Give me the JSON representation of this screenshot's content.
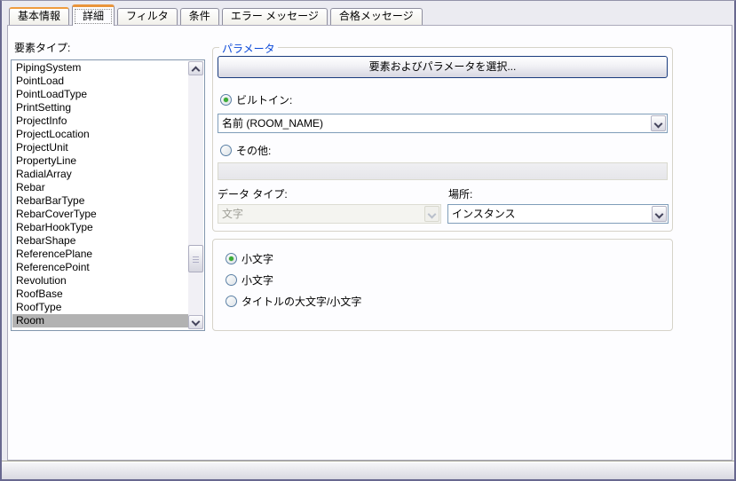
{
  "tabs": [
    {
      "label": "基本情報",
      "state": "hot"
    },
    {
      "label": "詳細",
      "state": "selected"
    },
    {
      "label": "フィルタ",
      "state": "normal"
    },
    {
      "label": "条件",
      "state": "normal"
    },
    {
      "label": "エラー メッセージ",
      "state": "normal"
    },
    {
      "label": "合格メッセージ",
      "state": "normal"
    }
  ],
  "element_types": {
    "label": "要素タイプ:",
    "items": [
      "PipingSystem",
      "PointLoad",
      "PointLoadType",
      "PrintSetting",
      "ProjectInfo",
      "ProjectLocation",
      "ProjectUnit",
      "PropertyLine",
      "RadialArray",
      "Rebar",
      "RebarBarType",
      "RebarCoverType",
      "RebarHookType",
      "RebarShape",
      "ReferencePlane",
      "ReferencePoint",
      "Revolution",
      "RoofBase",
      "RoofType",
      "Room"
    ],
    "selected_item": "Room"
  },
  "parameters": {
    "group_label": "パラメータ",
    "select_button_label": "要素およびパラメータを選択...",
    "builtin_radio_label": "ビルトイン:",
    "builtin_selected": true,
    "builtin_value": "名前 (ROOM_NAME)",
    "other_radio_label": "その他:",
    "other_selected": false,
    "other_value": "",
    "datatype_label": "データ タイプ:",
    "datatype_value": "文字",
    "datatype_enabled": false,
    "location_label": "場所:",
    "location_value": "インスタンス"
  },
  "case_options": {
    "options": [
      "小文字",
      "小文字",
      "タイトルの大文字/小文字"
    ],
    "selected_index": 0
  },
  "icons": {
    "scroll_up": "chevron-up-icon",
    "scroll_down": "chevron-down-icon",
    "combo_dropdown": "chevron-down-icon"
  },
  "colors": {
    "tab_accent_orange": "#E9953C",
    "group_label_blue": "#0B49D8",
    "radio_dot_green": "#3BAD36",
    "inactive_selection_gray": "#B2B2B2",
    "field_border_blue": "#7F9DB9",
    "default_button_border": "#1A3C7E"
  }
}
